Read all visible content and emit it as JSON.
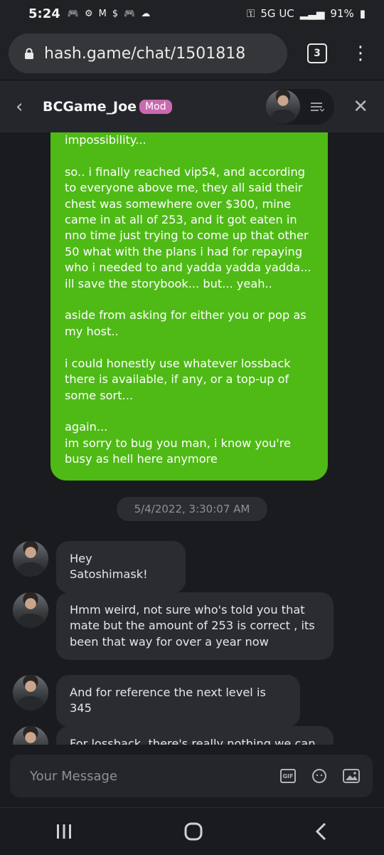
{
  "status_bar": {
    "time": "5:24",
    "network": "5G UC",
    "battery": "91%"
  },
  "browser": {
    "url": "hash.game/chat/1501818",
    "tab_count": "3"
  },
  "chat_header": {
    "title": "BCGame_Joe",
    "badge": "Mod"
  },
  "messages": {
    "outgoing": "impossibility...\n\nso.. i finally reached vip54, and according to everyone above me, they all said their chest was somewhere over $300, mine came in at all of 253, and it got eaten in nno time just trying to come up that other 50 what with the plans i had for repaying who i needed to and yadda yadda yadda... ill save the storybook... but... yeah..\n\naside from asking for either you or pop as my host..\n\ni could honestly use whatever lossback there is available, if any, or a top-up of some sort...\n\nagain...\nim sorry to bug you man, i know you're busy as hell here anymore",
    "timestamp": "5/4/2022, 3:30:07 AM",
    "incoming": [
      "Hey Satoshimask!",
      "Hmm weird, not sure who's told you that mate but the amount of 253 is correct , its been that way for over a year now",
      "And for reference the next level is 345",
      "For lossback, there's really nothing we can"
    ]
  },
  "composer": {
    "placeholder": "Your Message",
    "gif_label": "GIF"
  },
  "icons": {
    "lock": "lock-icon",
    "kebab": "more-vert-icon",
    "back": "chevron-left-icon",
    "menu": "menu-lines-icon",
    "close": "close-icon",
    "emoji": "emoji-icon",
    "image": "image-icon"
  },
  "colors": {
    "accent_green": "#4fba16",
    "mod_badge": "#c96ab0"
  }
}
